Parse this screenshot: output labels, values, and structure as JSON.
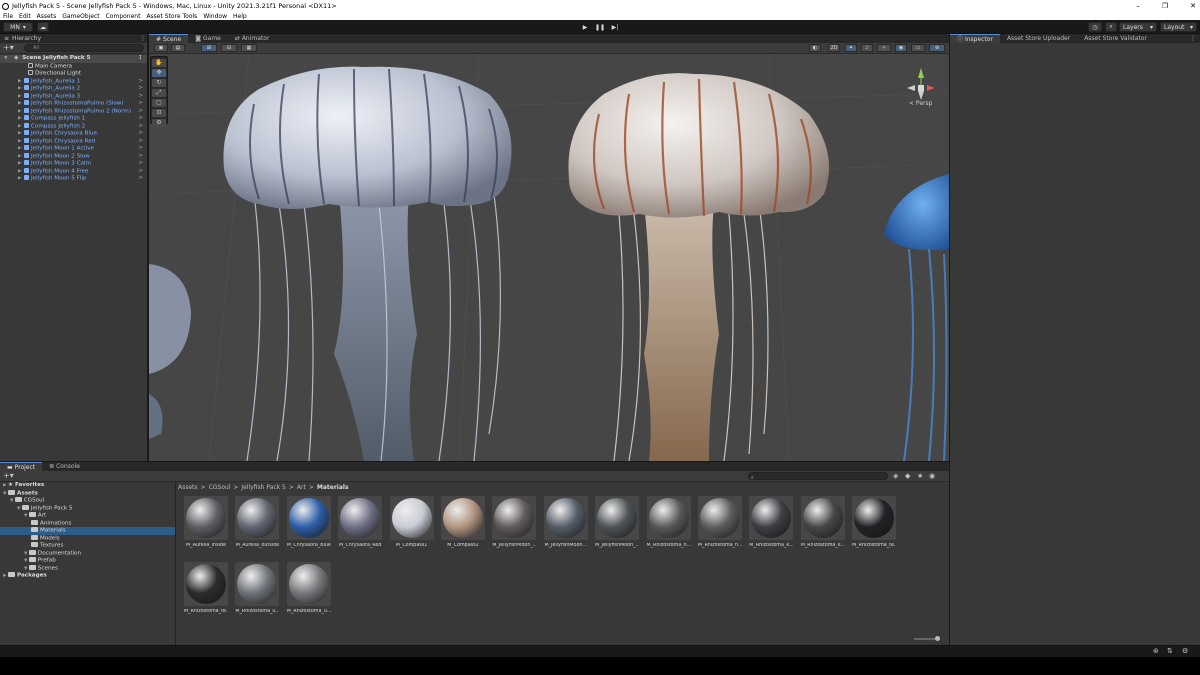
{
  "window": {
    "title": "Jellyfish Pack 5 - Scene Jellyfish Pack 5 - Windows, Mac, Linux - Unity 2021.3.21f1 Personal <DX11>",
    "controls": [
      "–",
      "❐",
      "✕"
    ]
  },
  "menu": [
    "File",
    "Edit",
    "Assets",
    "GameObject",
    "Component",
    "Asset Store Tools",
    "Window",
    "Help"
  ],
  "toolbar": {
    "account": "MN",
    "layers": "Layers",
    "layout": "Layout"
  },
  "hierarchy": {
    "tab": "Hierarchy",
    "search_placeholder": "All",
    "scene": "Scene Jellyfish Pack 5",
    "objects": [
      {
        "name": "Main Camera",
        "kind": "go"
      },
      {
        "name": "Directional Light",
        "kind": "go"
      },
      {
        "name": "Jellyfish_Aurelia 1",
        "kind": "prefab"
      },
      {
        "name": "Jellyfish_Aurelia 2",
        "kind": "prefab"
      },
      {
        "name": "Jellyfish_Aurelia 3",
        "kind": "prefab"
      },
      {
        "name": "Jellyfish RhizostomaPulmo (Slow)",
        "kind": "prefab"
      },
      {
        "name": "Jellyfish RhizostomaPulmo 2 (Norm)",
        "kind": "prefab"
      },
      {
        "name": "Compass Jellyfish 1",
        "kind": "prefab"
      },
      {
        "name": "Compass Jellyfish 2",
        "kind": "prefab"
      },
      {
        "name": "Jellyfish Chrysaora Blue",
        "kind": "prefab"
      },
      {
        "name": "Jellyfish Chrysaora Red",
        "kind": "prefab"
      },
      {
        "name": "Jellyfish Moon 1 Active",
        "kind": "prefab"
      },
      {
        "name": "Jellyfish Moon 2 Slow",
        "kind": "prefab"
      },
      {
        "name": "Jellyfish Moon 3 Calm",
        "kind": "prefab"
      },
      {
        "name": "Jellyfish Moon 4 Free",
        "kind": "prefab"
      },
      {
        "name": "Jellyfish Moon 5 Flip",
        "kind": "prefab"
      }
    ]
  },
  "scene_view": {
    "tabs": [
      "Scene",
      "Game",
      "Animator"
    ],
    "mode_2d": "2D",
    "persp": "< Persp"
  },
  "inspector": {
    "tabs": [
      "Inspector",
      "Asset Store Uploader",
      "Asset Store Validator"
    ]
  },
  "project": {
    "tabs": [
      "Project",
      "Console"
    ],
    "tree": [
      {
        "name": "Favorites",
        "level": 0,
        "bold": true,
        "icon": "star"
      },
      {
        "name": "Assets",
        "level": 0,
        "bold": true,
        "icon": "folder"
      },
      {
        "name": "CGSoul",
        "level": 1,
        "icon": "folder"
      },
      {
        "name": "Jellyfish Pack 5",
        "level": 2,
        "icon": "folder"
      },
      {
        "name": "Art",
        "level": 3,
        "icon": "folder"
      },
      {
        "name": "Animations",
        "level": 4,
        "icon": "folder"
      },
      {
        "name": "Materials",
        "level": 4,
        "icon": "folder",
        "selected": true
      },
      {
        "name": "Models",
        "level": 4,
        "icon": "folder"
      },
      {
        "name": "Textures",
        "level": 4,
        "icon": "folder"
      },
      {
        "name": "Documentation",
        "level": 3,
        "icon": "folder"
      },
      {
        "name": "Prefab",
        "level": 3,
        "icon": "folder"
      },
      {
        "name": "Scenes",
        "level": 3,
        "icon": "folder"
      },
      {
        "name": "Packages",
        "level": 0,
        "bold": true,
        "icon": "folder"
      }
    ],
    "breadcrumb": [
      "Assets",
      "CGSoul",
      "Jellyfish Pack 5",
      "Art",
      "Materials"
    ],
    "assets": [
      {
        "label": "M_Aurelia_inside",
        "color": "#5e6066"
      },
      {
        "label": "M_Aurelia_outside",
        "color": "#606570"
      },
      {
        "label": "M_Chrysaora_Blue",
        "color": "#2d5fa8"
      },
      {
        "label": "M_Chrysaora_Red",
        "color": "#6f6f86"
      },
      {
        "label": "M_Compass1",
        "color": "#c9ccd4"
      },
      {
        "label": "M_Compass2",
        "color": "#b39582"
      },
      {
        "label": "M_JellyfishMoon_...",
        "color": "#615b5d"
      },
      {
        "label": "M_JellyfishMoon...",
        "color": "#575e6a"
      },
      {
        "label": "M_JellyfishMoon_...",
        "color": "#505457"
      },
      {
        "label": "M_Rhizostoma_h...",
        "color": "#5a5a5a"
      },
      {
        "label": "M_Rhizostoma_h...",
        "color": "#5d5d5d"
      },
      {
        "label": "M_Rhizostoma_k...",
        "color": "#3e3e44"
      },
      {
        "label": "M_Rhizostoma_k...",
        "color": "#47474a"
      },
      {
        "label": "M_Rhizostoma_te...",
        "color": "#222226"
      },
      {
        "label": "M_Rhizostoma_te...",
        "color": "#2c2c2e"
      },
      {
        "label": "M_Rhizostoma_u...",
        "color": "#70747a"
      },
      {
        "label": "M_Rhizostoma_u...",
        "color": "#77797c"
      }
    ]
  }
}
